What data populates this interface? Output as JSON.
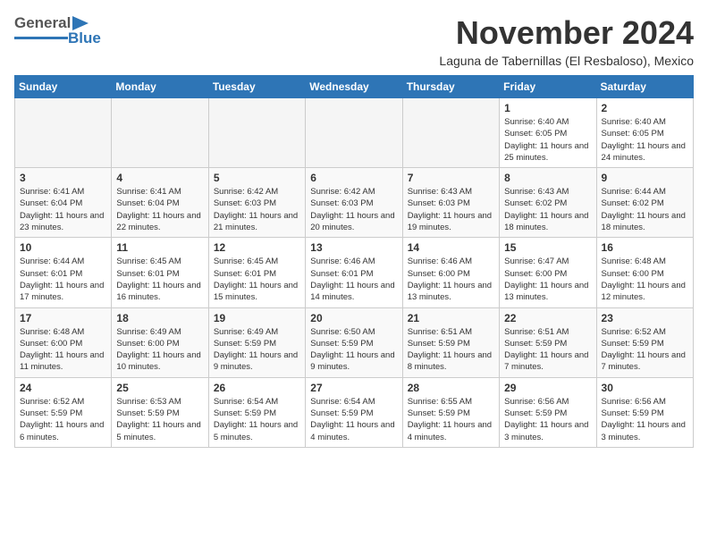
{
  "header": {
    "logo_general": "General",
    "logo_blue": "Blue",
    "month_title": "November 2024",
    "subtitle": "Laguna de Tabernillas (El Resbaloso), Mexico"
  },
  "days_of_week": [
    "Sunday",
    "Monday",
    "Tuesday",
    "Wednesday",
    "Thursday",
    "Friday",
    "Saturday"
  ],
  "weeks": [
    [
      {
        "day": "",
        "sunrise": "",
        "sunset": "",
        "daylight": "",
        "empty": true
      },
      {
        "day": "",
        "sunrise": "",
        "sunset": "",
        "daylight": "",
        "empty": true
      },
      {
        "day": "",
        "sunrise": "",
        "sunset": "",
        "daylight": "",
        "empty": true
      },
      {
        "day": "",
        "sunrise": "",
        "sunset": "",
        "daylight": "",
        "empty": true
      },
      {
        "day": "",
        "sunrise": "",
        "sunset": "",
        "daylight": "",
        "empty": true
      },
      {
        "day": "1",
        "sunrise": "Sunrise: 6:40 AM",
        "sunset": "Sunset: 6:05 PM",
        "daylight": "Daylight: 11 hours and 25 minutes.",
        "empty": false
      },
      {
        "day": "2",
        "sunrise": "Sunrise: 6:40 AM",
        "sunset": "Sunset: 6:05 PM",
        "daylight": "Daylight: 11 hours and 24 minutes.",
        "empty": false
      }
    ],
    [
      {
        "day": "3",
        "sunrise": "Sunrise: 6:41 AM",
        "sunset": "Sunset: 6:04 PM",
        "daylight": "Daylight: 11 hours and 23 minutes.",
        "empty": false
      },
      {
        "day": "4",
        "sunrise": "Sunrise: 6:41 AM",
        "sunset": "Sunset: 6:04 PM",
        "daylight": "Daylight: 11 hours and 22 minutes.",
        "empty": false
      },
      {
        "day": "5",
        "sunrise": "Sunrise: 6:42 AM",
        "sunset": "Sunset: 6:03 PM",
        "daylight": "Daylight: 11 hours and 21 minutes.",
        "empty": false
      },
      {
        "day": "6",
        "sunrise": "Sunrise: 6:42 AM",
        "sunset": "Sunset: 6:03 PM",
        "daylight": "Daylight: 11 hours and 20 minutes.",
        "empty": false
      },
      {
        "day": "7",
        "sunrise": "Sunrise: 6:43 AM",
        "sunset": "Sunset: 6:03 PM",
        "daylight": "Daylight: 11 hours and 19 minutes.",
        "empty": false
      },
      {
        "day": "8",
        "sunrise": "Sunrise: 6:43 AM",
        "sunset": "Sunset: 6:02 PM",
        "daylight": "Daylight: 11 hours and 18 minutes.",
        "empty": false
      },
      {
        "day": "9",
        "sunrise": "Sunrise: 6:44 AM",
        "sunset": "Sunset: 6:02 PM",
        "daylight": "Daylight: 11 hours and 18 minutes.",
        "empty": false
      }
    ],
    [
      {
        "day": "10",
        "sunrise": "Sunrise: 6:44 AM",
        "sunset": "Sunset: 6:01 PM",
        "daylight": "Daylight: 11 hours and 17 minutes.",
        "empty": false
      },
      {
        "day": "11",
        "sunrise": "Sunrise: 6:45 AM",
        "sunset": "Sunset: 6:01 PM",
        "daylight": "Daylight: 11 hours and 16 minutes.",
        "empty": false
      },
      {
        "day": "12",
        "sunrise": "Sunrise: 6:45 AM",
        "sunset": "Sunset: 6:01 PM",
        "daylight": "Daylight: 11 hours and 15 minutes.",
        "empty": false
      },
      {
        "day": "13",
        "sunrise": "Sunrise: 6:46 AM",
        "sunset": "Sunset: 6:01 PM",
        "daylight": "Daylight: 11 hours and 14 minutes.",
        "empty": false
      },
      {
        "day": "14",
        "sunrise": "Sunrise: 6:46 AM",
        "sunset": "Sunset: 6:00 PM",
        "daylight": "Daylight: 11 hours and 13 minutes.",
        "empty": false
      },
      {
        "day": "15",
        "sunrise": "Sunrise: 6:47 AM",
        "sunset": "Sunset: 6:00 PM",
        "daylight": "Daylight: 11 hours and 13 minutes.",
        "empty": false
      },
      {
        "day": "16",
        "sunrise": "Sunrise: 6:48 AM",
        "sunset": "Sunset: 6:00 PM",
        "daylight": "Daylight: 11 hours and 12 minutes.",
        "empty": false
      }
    ],
    [
      {
        "day": "17",
        "sunrise": "Sunrise: 6:48 AM",
        "sunset": "Sunset: 6:00 PM",
        "daylight": "Daylight: 11 hours and 11 minutes.",
        "empty": false
      },
      {
        "day": "18",
        "sunrise": "Sunrise: 6:49 AM",
        "sunset": "Sunset: 6:00 PM",
        "daylight": "Daylight: 11 hours and 10 minutes.",
        "empty": false
      },
      {
        "day": "19",
        "sunrise": "Sunrise: 6:49 AM",
        "sunset": "Sunset: 5:59 PM",
        "daylight": "Daylight: 11 hours and 9 minutes.",
        "empty": false
      },
      {
        "day": "20",
        "sunrise": "Sunrise: 6:50 AM",
        "sunset": "Sunset: 5:59 PM",
        "daylight": "Daylight: 11 hours and 9 minutes.",
        "empty": false
      },
      {
        "day": "21",
        "sunrise": "Sunrise: 6:51 AM",
        "sunset": "Sunset: 5:59 PM",
        "daylight": "Daylight: 11 hours and 8 minutes.",
        "empty": false
      },
      {
        "day": "22",
        "sunrise": "Sunrise: 6:51 AM",
        "sunset": "Sunset: 5:59 PM",
        "daylight": "Daylight: 11 hours and 7 minutes.",
        "empty": false
      },
      {
        "day": "23",
        "sunrise": "Sunrise: 6:52 AM",
        "sunset": "Sunset: 5:59 PM",
        "daylight": "Daylight: 11 hours and 7 minutes.",
        "empty": false
      }
    ],
    [
      {
        "day": "24",
        "sunrise": "Sunrise: 6:52 AM",
        "sunset": "Sunset: 5:59 PM",
        "daylight": "Daylight: 11 hours and 6 minutes.",
        "empty": false
      },
      {
        "day": "25",
        "sunrise": "Sunrise: 6:53 AM",
        "sunset": "Sunset: 5:59 PM",
        "daylight": "Daylight: 11 hours and 5 minutes.",
        "empty": false
      },
      {
        "day": "26",
        "sunrise": "Sunrise: 6:54 AM",
        "sunset": "Sunset: 5:59 PM",
        "daylight": "Daylight: 11 hours and 5 minutes.",
        "empty": false
      },
      {
        "day": "27",
        "sunrise": "Sunrise: 6:54 AM",
        "sunset": "Sunset: 5:59 PM",
        "daylight": "Daylight: 11 hours and 4 minutes.",
        "empty": false
      },
      {
        "day": "28",
        "sunrise": "Sunrise: 6:55 AM",
        "sunset": "Sunset: 5:59 PM",
        "daylight": "Daylight: 11 hours and 4 minutes.",
        "empty": false
      },
      {
        "day": "29",
        "sunrise": "Sunrise: 6:56 AM",
        "sunset": "Sunset: 5:59 PM",
        "daylight": "Daylight: 11 hours and 3 minutes.",
        "empty": false
      },
      {
        "day": "30",
        "sunrise": "Sunrise: 6:56 AM",
        "sunset": "Sunset: 5:59 PM",
        "daylight": "Daylight: 11 hours and 3 minutes.",
        "empty": false
      }
    ]
  ]
}
